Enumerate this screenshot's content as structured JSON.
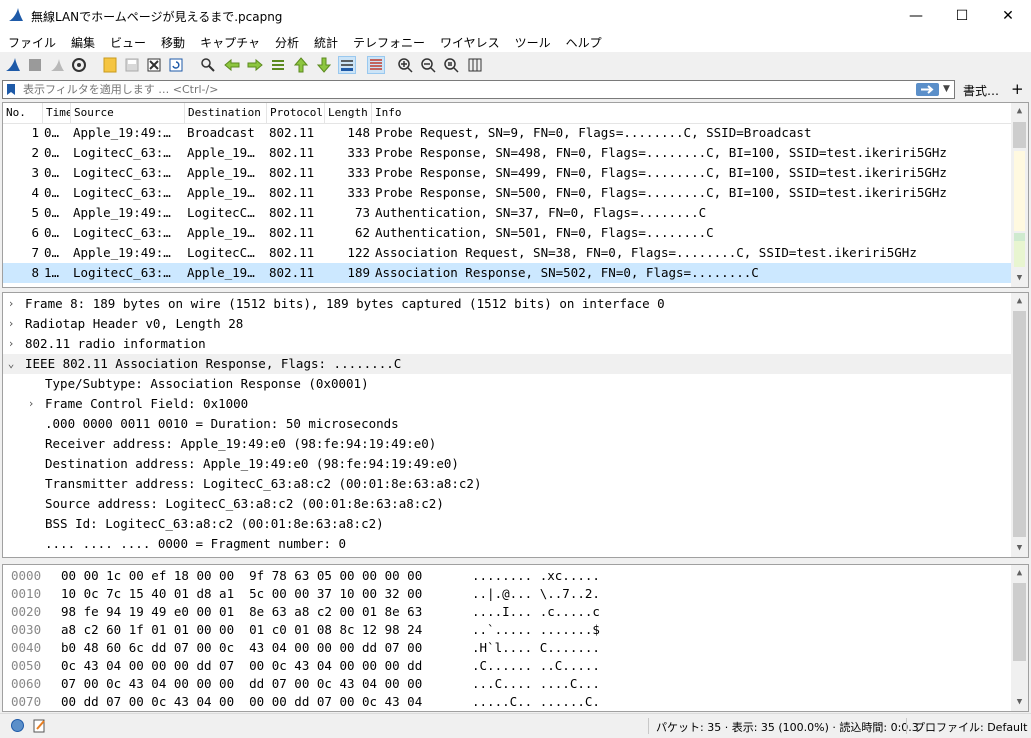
{
  "window": {
    "title": "無線LANでホームページが見えるまで.pcapng",
    "minimize": "—",
    "maximize": "☐",
    "close": "✕"
  },
  "menu": [
    "ファイル",
    "編集",
    "ビュー",
    "移動",
    "キャプチャ",
    "分析",
    "統計",
    "テレフォニー",
    "ワイヤレス",
    "ツール",
    "ヘルプ"
  ],
  "filter": {
    "placeholder": "表示フィルタを適用します … <Ctrl-/>",
    "value": "",
    "expressions_label": "書式…",
    "add_label": "+"
  },
  "packet_list": {
    "columns": [
      "No.",
      "Time",
      "Source",
      "Destination",
      "Protocol",
      "Length",
      "Info"
    ],
    "rows": [
      {
        "no": "1",
        "time": "0…",
        "src": "Apple_19:49:…",
        "dst": "Broadcast",
        "proto": "802.11",
        "len": "148",
        "info": "Probe Request, SN=9, FN=0, Flags=........C, SSID=Broadcast"
      },
      {
        "no": "2",
        "time": "0…",
        "src": "LogitecC_63:…",
        "dst": "Apple_19…",
        "proto": "802.11",
        "len": "333",
        "info": "Probe Response, SN=498, FN=0, Flags=........C, BI=100, SSID=test.ikeriri5GHz"
      },
      {
        "no": "3",
        "time": "0…",
        "src": "LogitecC_63:…",
        "dst": "Apple_19…",
        "proto": "802.11",
        "len": "333",
        "info": "Probe Response, SN=499, FN=0, Flags=........C, BI=100, SSID=test.ikeriri5GHz"
      },
      {
        "no": "4",
        "time": "0…",
        "src": "LogitecC_63:…",
        "dst": "Apple_19…",
        "proto": "802.11",
        "len": "333",
        "info": "Probe Response, SN=500, FN=0, Flags=........C, BI=100, SSID=test.ikeriri5GHz"
      },
      {
        "no": "5",
        "time": "0…",
        "src": "Apple_19:49:…",
        "dst": "LogitecC…",
        "proto": "802.11",
        "len": "73",
        "info": "Authentication, SN=37, FN=0, Flags=........C"
      },
      {
        "no": "6",
        "time": "0…",
        "src": "LogitecC_63:…",
        "dst": "Apple_19…",
        "proto": "802.11",
        "len": "62",
        "info": "Authentication, SN=501, FN=0, Flags=........C"
      },
      {
        "no": "7",
        "time": "0…",
        "src": "Apple_19:49:…",
        "dst": "LogitecC…",
        "proto": "802.11",
        "len": "122",
        "info": "Association Request, SN=38, FN=0, Flags=........C, SSID=test.ikeriri5GHz"
      },
      {
        "no": "8",
        "time": "1…",
        "src": "LogitecC_63:…",
        "dst": "Apple_19…",
        "proto": "802.11",
        "len": "189",
        "info": "Association Response, SN=502, FN=0, Flags=........C"
      }
    ],
    "selected_index": 7
  },
  "details": [
    {
      "arrow": "›",
      "indent": 0,
      "text": "Frame 8: 189 bytes on wire (1512 bits), 189 bytes captured (1512 bits) on interface 0"
    },
    {
      "arrow": "›",
      "indent": 0,
      "text": "Radiotap Header v0, Length 28"
    },
    {
      "arrow": "›",
      "indent": 0,
      "text": "802.11 radio information"
    },
    {
      "arrow": "⌄",
      "indent": 0,
      "text": "IEEE 802.11 Association Response, Flags: ........C"
    },
    {
      "arrow": "",
      "indent": 1,
      "text": "Type/Subtype: Association Response (0x0001)"
    },
    {
      "arrow": "›",
      "indent": 1,
      "text": "Frame Control Field: 0x1000"
    },
    {
      "arrow": "",
      "indent": 1,
      "text": ".000 0000 0011 0010 = Duration: 50 microseconds"
    },
    {
      "arrow": "",
      "indent": 1,
      "text": "Receiver address: Apple_19:49:e0 (98:fe:94:19:49:e0)"
    },
    {
      "arrow": "",
      "indent": 1,
      "text": "Destination address: Apple_19:49:e0 (98:fe:94:19:49:e0)"
    },
    {
      "arrow": "",
      "indent": 1,
      "text": "Transmitter address: LogitecC_63:a8:c2 (00:01:8e:63:a8:c2)"
    },
    {
      "arrow": "",
      "indent": 1,
      "text": "Source address: LogitecC_63:a8:c2 (00:01:8e:63:a8:c2)"
    },
    {
      "arrow": "",
      "indent": 1,
      "text": "BSS Id: LogitecC_63:a8:c2 (00:01:8e:63:a8:c2)"
    },
    {
      "arrow": "",
      "indent": 1,
      "text": ".... .... .... 0000 = Fragment number: 0"
    }
  ],
  "details_highlight_index": 3,
  "bytes": [
    {
      "off": "0000",
      "hex": "00 00 1c 00 ef 18 00 00  9f 78 63 05 00 00 00 00",
      "ascii": "........ .xc....."
    },
    {
      "off": "0010",
      "hex": "10 0c 7c 15 40 01 d8 a1  5c 00 00 37 10 00 32 00",
      "ascii": "..|.@... \\..7..2."
    },
    {
      "off": "0020",
      "hex": "98 fe 94 19 49 e0 00 01  8e 63 a8 c2 00 01 8e 63",
      "ascii": "....I... .c.....c"
    },
    {
      "off": "0030",
      "hex": "a8 c2 60 1f 01 01 00 00  01 c0 01 08 8c 12 98 24",
      "ascii": "..`..... .......$"
    },
    {
      "off": "0040",
      "hex": "b0 48 60 6c dd 07 00 0c  43 04 00 00 00 dd 07 00",
      "ascii": ".H`l.... C......."
    },
    {
      "off": "0050",
      "hex": "0c 43 04 00 00 00 dd 07  00 0c 43 04 00 00 00 dd",
      "ascii": ".C...... ..C....."
    },
    {
      "off": "0060",
      "hex": "07 00 0c 43 04 00 00 00  dd 07 00 0c 43 04 00 00",
      "ascii": "...C.... ....C..."
    },
    {
      "off": "0070",
      "hex": "00 dd 07 00 0c 43 04 00  00 00 dd 07 00 0c 43 04",
      "ascii": ".....C.. ......C."
    }
  ],
  "status": {
    "packets": "パケット: 35 · 表示: 35 (100.0%) · 読込時間: 0:0.3",
    "profile": "プロファイル: Default"
  },
  "colors": {
    "selection": "#cce8ff",
    "accent": "#1e5aa8",
    "filter_apply": "#5b8fc9"
  }
}
